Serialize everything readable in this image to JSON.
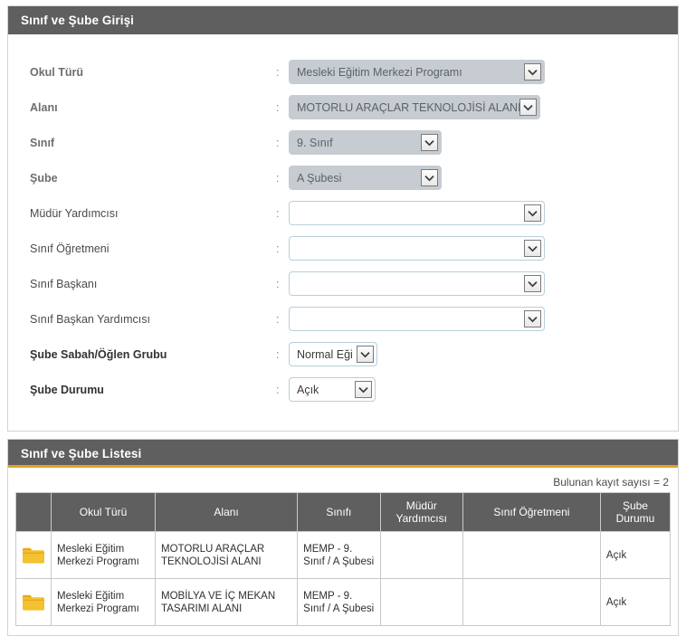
{
  "form_panel": {
    "title": "Sınıf ve Şube Girişi",
    "fields": [
      {
        "label": "Okul Türü",
        "colon": ":",
        "value": "Mesleki Eğitim Merkezi Programı",
        "disabled": true,
        "size": "lg",
        "label_style": "dim"
      },
      {
        "label": "Alanı",
        "colon": ":",
        "value": "MOTORLU ARAÇLAR TEKNOLOJİSİ ALANI",
        "disabled": true,
        "size": "md",
        "label_style": "dim"
      },
      {
        "label": "Sınıf",
        "colon": ":",
        "value": "9. Sınıf",
        "disabled": true,
        "size": "sm",
        "label_style": "dim"
      },
      {
        "label": "Şube",
        "colon": ":",
        "value": "A Şubesi",
        "disabled": true,
        "size": "sm",
        "label_style": "dim"
      },
      {
        "label": "Müdür Yardımcısı",
        "colon": ":",
        "value": "",
        "disabled": false,
        "size": "lg",
        "label_style": "normal"
      },
      {
        "label": "Sınıf Öğretmeni",
        "colon": ":",
        "value": "",
        "disabled": false,
        "size": "lg",
        "label_style": "normal"
      },
      {
        "label": "Sınıf Başkanı",
        "colon": ":",
        "value": "",
        "disabled": false,
        "size": "lg",
        "label_style": "normal"
      },
      {
        "label": "Sınıf Başkan Yardımcısı",
        "colon": ":",
        "value": "",
        "disabled": false,
        "size": "lg",
        "label_style": "normal"
      },
      {
        "label": "Şube Sabah/Öğlen Grubu",
        "colon": ":",
        "value": "Normal Eği",
        "disabled": false,
        "size": "xs",
        "label_style": "strong"
      },
      {
        "label": "Şube Durumu",
        "colon": ":",
        "value": "Açık",
        "disabled": false,
        "size": "xxs",
        "label_style": "strong"
      }
    ]
  },
  "list_panel": {
    "title": "Sınıf ve Şube Listesi",
    "record_count_text": "Bulunan kayıt sayısı = 2",
    "columns": [
      {
        "key": "icon",
        "label": ""
      },
      {
        "key": "okul",
        "label": "Okul Türü"
      },
      {
        "key": "alan",
        "label": "Alanı"
      },
      {
        "key": "sinif",
        "label": "Sınıfı"
      },
      {
        "key": "mudur",
        "label": "Müdür Yardımcısı"
      },
      {
        "key": "ogret",
        "label": "Sınıf Öğretmeni"
      },
      {
        "key": "durum",
        "label": "Şube Durumu"
      }
    ],
    "rows": [
      {
        "icon": "folder-icon",
        "okul": "Mesleki Eğitim Merkezi Programı",
        "alan": "MOTORLU ARAÇLAR TEKNOLOJİSİ ALANI",
        "sinif": "MEMP - 9. Sınıf / A Şubesi",
        "mudur": "",
        "ogret": "",
        "durum": "Açık"
      },
      {
        "icon": "folder-icon",
        "okul": "Mesleki Eğitim Merkezi Programı",
        "alan": "MOBİLYA VE İÇ MEKAN TASARIMI ALANI",
        "sinif": "MEMP - 9. Sınıf / A Şubesi",
        "mudur": "",
        "ogret": "",
        "durum": "Açık"
      }
    ]
  },
  "colors": {
    "panel_header_bg": "#5f5f5f",
    "accent_gold": "#e0a423",
    "folder_icon": "#f2c230",
    "disabled_field_bg": "#c6ccd1",
    "field_border": "#b7cfdb"
  }
}
